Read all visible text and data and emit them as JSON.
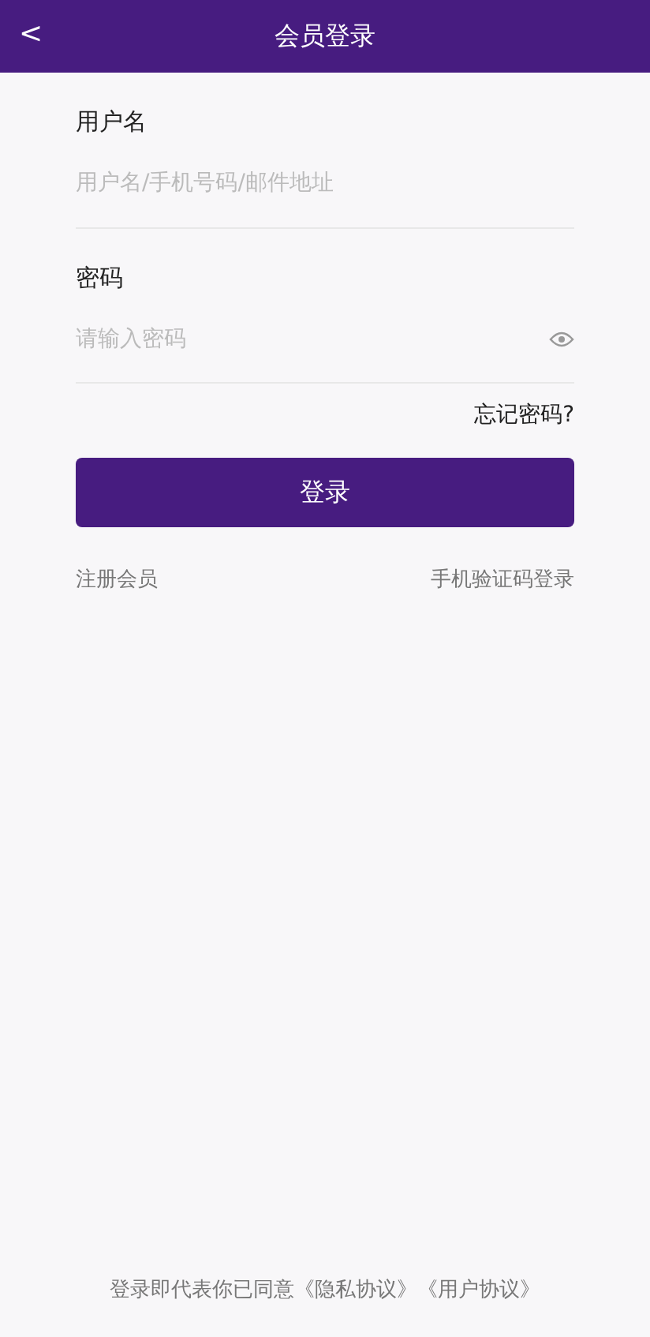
{
  "header": {
    "back": "<",
    "title": "会员登录"
  },
  "fields": [
    {
      "label": "用户名",
      "placeholder": "用户名/手机号码/邮件地址",
      "kind": "text"
    },
    {
      "label": "密码",
      "placeholder": "请输入密码",
      "kind": "password"
    }
  ],
  "forgot": "忘记密码?",
  "login_button": "登录",
  "links": [
    "注册会员",
    "手机验证码登录"
  ],
  "footer": "登录即代表你已同意《隐私协议》《用户协议》"
}
